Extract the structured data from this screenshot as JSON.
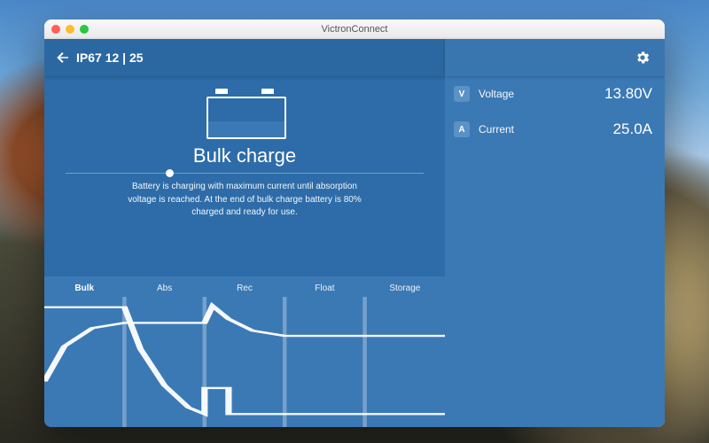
{
  "window": {
    "title": "VictronConnect"
  },
  "header": {
    "device": "IP67 12 | 25"
  },
  "stage": {
    "title": "Bulk charge",
    "description": "Battery is charging with maximum current until absorption voltage is reached. At the end of bulk charge battery is  80% charged and ready for use."
  },
  "phases": [
    {
      "label": "Bulk",
      "active": true
    },
    {
      "label": "Abs",
      "active": false
    },
    {
      "label": "Rec",
      "active": false
    },
    {
      "label": "Float",
      "active": false
    },
    {
      "label": "Storage",
      "active": false
    }
  ],
  "readings": {
    "voltage": {
      "label": "Voltage",
      "value": "13.80V",
      "icon": "V"
    },
    "current": {
      "label": "Current",
      "value": "25.0A",
      "icon": "A"
    }
  },
  "chart_data": {
    "type": "line",
    "note": "schematic charge-profile curves; y values are 0..1 normalized (no numeric axes visible).",
    "phase_boundaries_x": [
      0,
      0.2,
      0.4,
      0.6,
      0.8,
      1.0
    ],
    "phase_names": [
      "Bulk",
      "Abs",
      "Rec",
      "Float",
      "Storage"
    ],
    "series": [
      {
        "name": "voltage",
        "points": [
          {
            "x": 0.0,
            "y": 0.35
          },
          {
            "x": 0.05,
            "y": 0.62
          },
          {
            "x": 0.12,
            "y": 0.76
          },
          {
            "x": 0.2,
            "y": 0.8
          },
          {
            "x": 0.35,
            "y": 0.8
          },
          {
            "x": 0.4,
            "y": 0.8
          },
          {
            "x": 0.42,
            "y": 0.93
          },
          {
            "x": 0.46,
            "y": 0.83
          },
          {
            "x": 0.52,
            "y": 0.74
          },
          {
            "x": 0.6,
            "y": 0.7
          },
          {
            "x": 0.8,
            "y": 0.7
          },
          {
            "x": 1.0,
            "y": 0.7
          }
        ]
      },
      {
        "name": "current",
        "points": [
          {
            "x": 0.0,
            "y": 0.92
          },
          {
            "x": 0.2,
            "y": 0.92
          },
          {
            "x": 0.24,
            "y": 0.6
          },
          {
            "x": 0.3,
            "y": 0.32
          },
          {
            "x": 0.36,
            "y": 0.15
          },
          {
            "x": 0.4,
            "y": 0.1
          },
          {
            "x": 0.4,
            "y": 0.3
          },
          {
            "x": 0.46,
            "y": 0.3
          },
          {
            "x": 0.46,
            "y": 0.1
          },
          {
            "x": 0.6,
            "y": 0.1
          },
          {
            "x": 0.8,
            "y": 0.1
          },
          {
            "x": 1.0,
            "y": 0.1
          }
        ]
      }
    ]
  }
}
